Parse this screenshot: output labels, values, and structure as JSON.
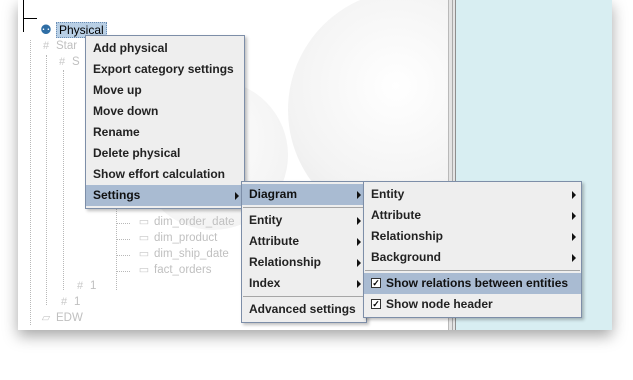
{
  "tree": {
    "root_label": "Physical",
    "ghost_nodes": [
      "Star",
      "S",
      "dim_order_date",
      "dim_product",
      "dim_ship_date",
      "fact_orders",
      "1",
      "1",
      "EDW"
    ]
  },
  "main_menu": {
    "items": [
      {
        "label": "Add physical",
        "submenu": false
      },
      {
        "label": "Export category settings",
        "submenu": false
      },
      {
        "label": "Move up",
        "submenu": false
      },
      {
        "label": "Move down",
        "submenu": false
      },
      {
        "label": "Rename",
        "submenu": false
      },
      {
        "label": "Delete physical",
        "submenu": false
      },
      {
        "label": "Show effort calculation",
        "submenu": false
      },
      {
        "label": "Settings",
        "submenu": true,
        "active": true
      }
    ]
  },
  "settings_menu": {
    "items": [
      {
        "label": "Diagram",
        "submenu": true,
        "active": true
      },
      {
        "label": "Entity",
        "submenu": true
      },
      {
        "label": "Attribute",
        "submenu": true
      },
      {
        "label": "Relationship",
        "submenu": true
      },
      {
        "label": "Index",
        "submenu": true
      },
      {
        "label": "Advanced settings",
        "submenu": false
      }
    ]
  },
  "diagram_menu": {
    "items": [
      {
        "label": "Entity",
        "submenu": true
      },
      {
        "label": "Attribute",
        "submenu": true
      },
      {
        "label": "Relationship",
        "submenu": true
      },
      {
        "label": "Background",
        "submenu": true
      },
      {
        "label": "Show relations between entities",
        "checked": true,
        "active": true
      },
      {
        "label": "Show node header",
        "checked": true
      }
    ]
  },
  "colors": {
    "menu_bg": "#eeeeee",
    "menu_highlight": "#a9bbd2",
    "right_panel": "#d8eef2",
    "tree_selection": "#b8cfe5"
  }
}
